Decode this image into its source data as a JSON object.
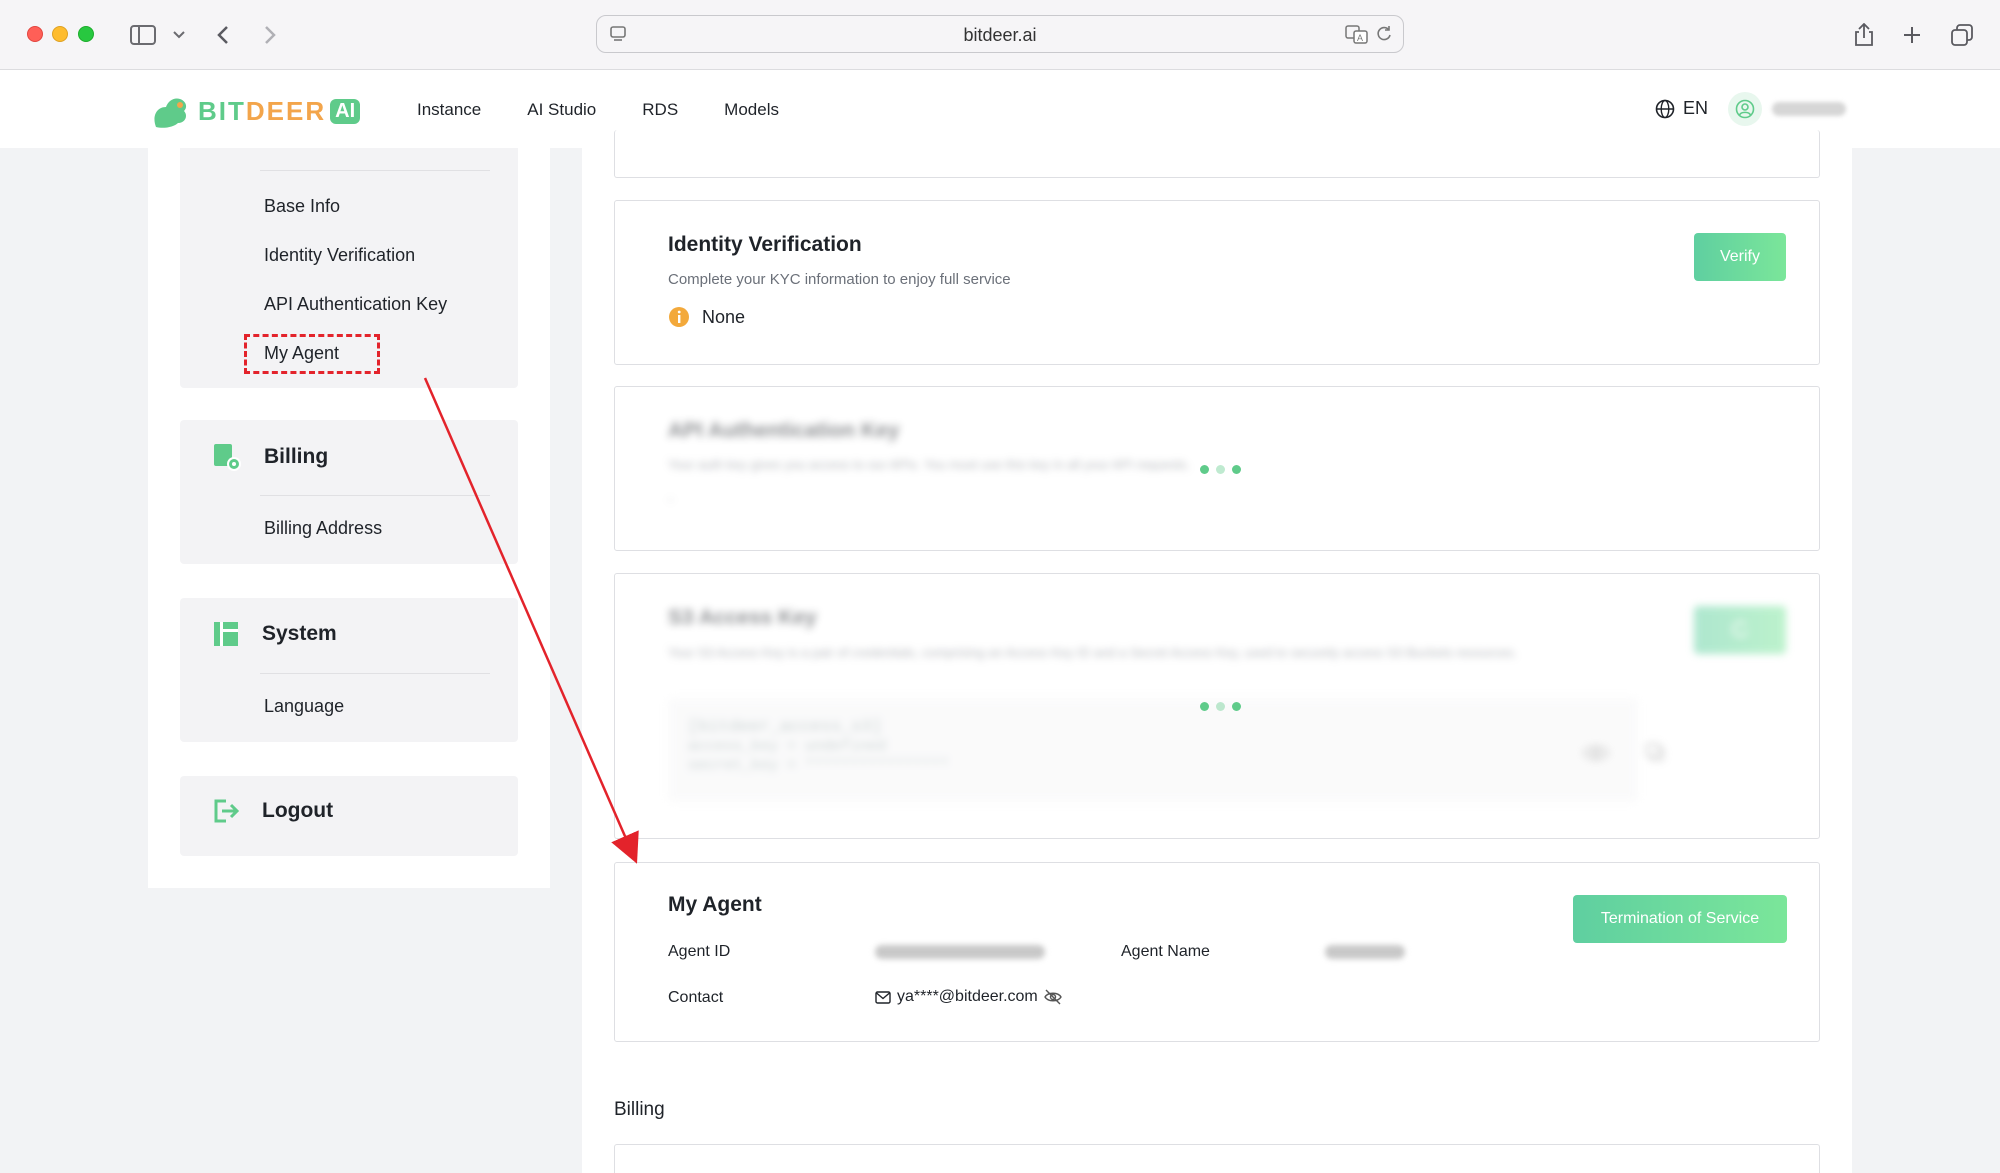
{
  "browser": {
    "url": "bitdeer.ai"
  },
  "header": {
    "logo_text_a": "BIT",
    "logo_text_b": "DEER",
    "logo_badge": "AI",
    "nav": [
      "Instance",
      "AI Studio",
      "RDS",
      "Models"
    ],
    "language": "EN"
  },
  "sidebar": {
    "account_links": [
      "Base Info",
      "Identity Verification",
      "API Authentication Key",
      "My Agent"
    ],
    "billing": {
      "title": "Billing",
      "links": [
        "Billing Address"
      ]
    },
    "system": {
      "title": "System",
      "links": [
        "Language"
      ]
    },
    "logout": "Logout"
  },
  "identity": {
    "title": "Identity Verification",
    "subtitle": "Complete your KYC information to enjoy full service",
    "status": "None",
    "button": "Verify"
  },
  "api_key": {
    "title": "API Authentication Key",
    "subtitle": "Your auth key gives you access to our APIs. You must use this key in all your API requests.",
    "value": "-"
  },
  "s3_key": {
    "title": "S3 Access Key",
    "subtitle": "Your S3 Access Key is a pair of credentials, comprising an Access Key ID and a Secret Access Key, used to securely access S3 Buckets resources.",
    "code_line1": "[bitdeer_access_s3]",
    "code_line2": "access_key = undefined",
    "code_line3": "secret_key = ****************"
  },
  "agent": {
    "title": "My Agent",
    "button": "Termination of Service",
    "agent_id_label": "Agent ID",
    "agent_name_label": "Agent Name",
    "contact_label": "Contact",
    "contact_value": "ya****@bitdeer.com"
  },
  "billing_section": "Billing",
  "colors": {
    "brand_green": "#5fcb8a",
    "brand_orange": "#f3a54b",
    "annotation_red": "#e3232b"
  }
}
